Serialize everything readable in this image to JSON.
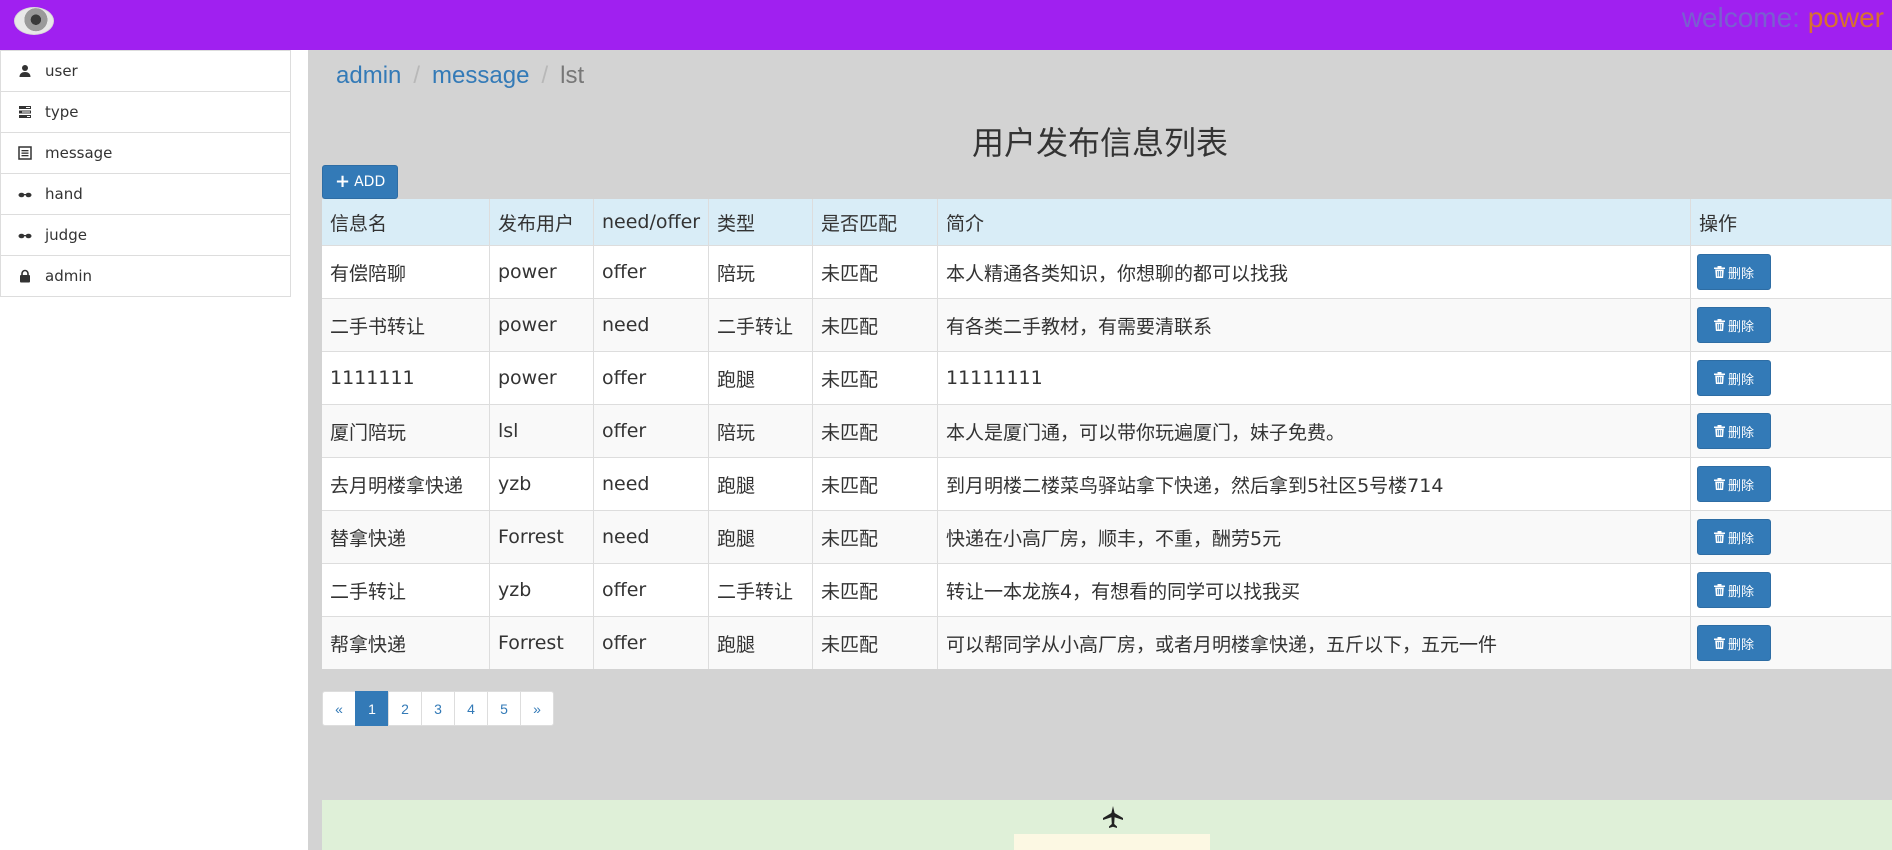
{
  "header": {
    "welcome_prefix": "welcome:",
    "username": "power"
  },
  "sidebar": {
    "items": [
      {
        "label": "user",
        "icon": "user-icon"
      },
      {
        "label": "type",
        "icon": "tasks-icon"
      },
      {
        "label": "message",
        "icon": "list-alt-icon"
      },
      {
        "label": "hand",
        "icon": "sunglasses-icon"
      },
      {
        "label": "judge",
        "icon": "sunglasses-icon"
      },
      {
        "label": "admin",
        "icon": "lock-icon"
      }
    ]
  },
  "breadcrumb": {
    "items": [
      "admin",
      "message"
    ],
    "separator": "/",
    "current": "lst"
  },
  "page_title": "用户发布信息列表",
  "toolbar": {
    "add_label": "ADD"
  },
  "table": {
    "columns": [
      "信息名",
      "发布用户",
      "need/offer",
      "类型",
      "是否匹配",
      "简介",
      "操作"
    ],
    "delete_label": "删除",
    "rows": [
      [
        "有偿陪聊",
        "power",
        "offer",
        "陪玩",
        "未匹配",
        "本人精通各类知识，你想聊的都可以找我"
      ],
      [
        "二手书转让",
        "power",
        "need",
        "二手转让",
        "未匹配",
        "有各类二手教材，有需要清联系"
      ],
      [
        "1111111",
        "power",
        "offer",
        "跑腿",
        "未匹配",
        "11111111"
      ],
      [
        "厦门陪玩",
        "lsl",
        "offer",
        "陪玩",
        "未匹配",
        "本人是厦门通，可以带你玩遍厦门，妹子免费。"
      ],
      [
        "去月明楼拿快递",
        "yzb",
        "need",
        "跑腿",
        "未匹配",
        "到月明楼二楼菜鸟驿站拿下快递，然后拿到5社区5号楼714"
      ],
      [
        "替拿快递",
        "Forrest",
        "need",
        "跑腿",
        "未匹配",
        "快递在小高厂房，顺丰，不重，酬劳5元"
      ],
      [
        "二手转让",
        "yzb",
        "offer",
        "二手转让",
        "未匹配",
        "转让一本龙族4，有想看的同学可以找我买"
      ],
      [
        "帮拿快递",
        "Forrest",
        "offer",
        "跑腿",
        "未匹配",
        "可以帮同学从小高厂房，或者月明楼拿快递，五斤以下，五元一件"
      ]
    ]
  },
  "pagination": {
    "prev": "«",
    "pages": [
      "1",
      "2",
      "3",
      "4",
      "5"
    ],
    "active": "1",
    "next": "»"
  },
  "colors": {
    "topbar": "#a020f0",
    "primary": "#337ab7",
    "table_header": "#d9edf7",
    "footer_panel": "#dff0d8"
  }
}
